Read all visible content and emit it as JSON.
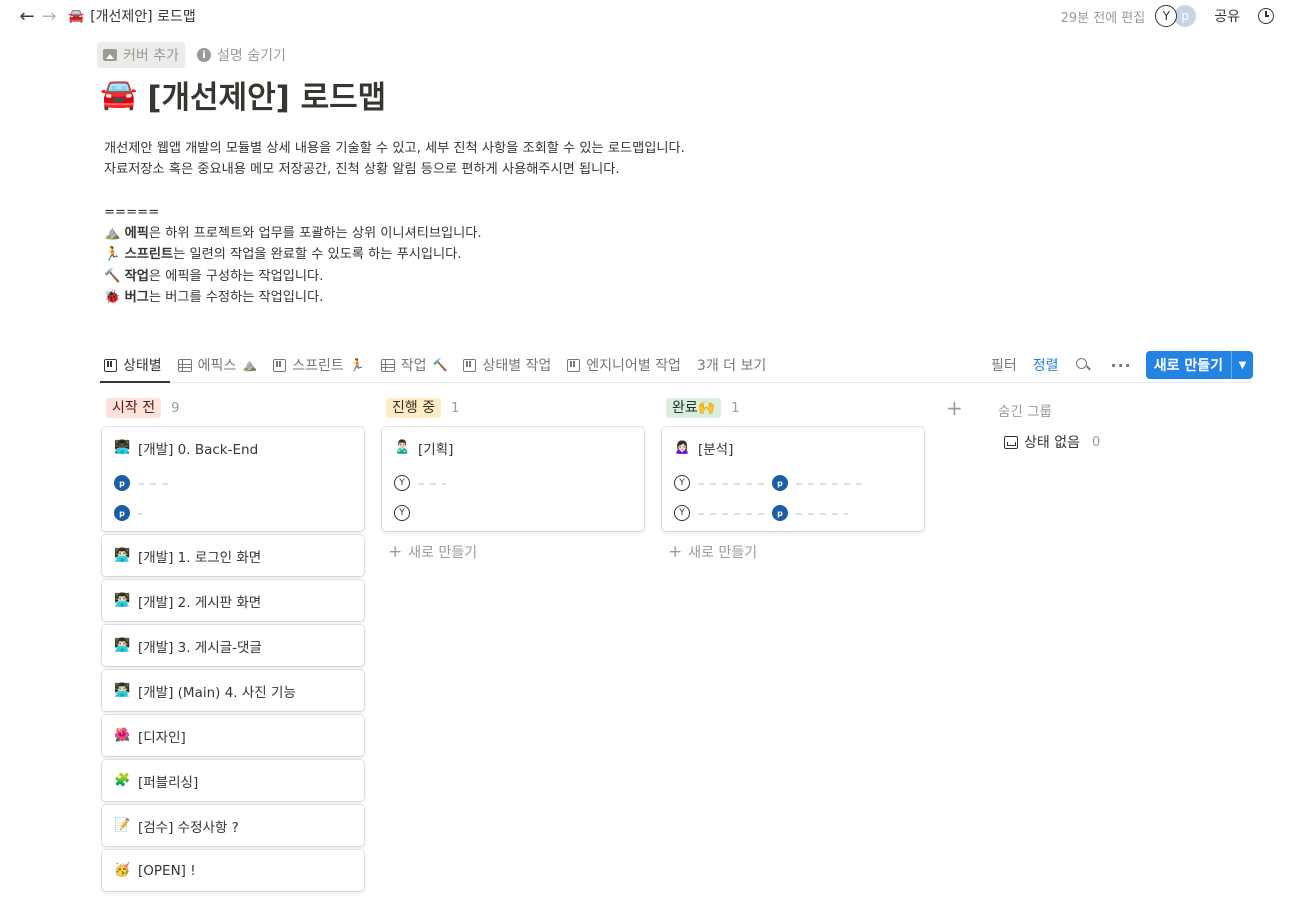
{
  "topbar": {
    "back_icon": "arrow-left-icon",
    "forward_icon": "arrow-right-icon",
    "page_icon": "🚘",
    "breadcrumb": "[개선제안] 로드맵",
    "edited": "29분 전에 편집",
    "avatar_y": "Y",
    "avatar_p": "p",
    "share": "공유",
    "history_icon": "clock-icon"
  },
  "page": {
    "add_cover": "커버 추가",
    "hide_description": "설명 숨기기",
    "title_icon": "🚘",
    "title": "[개선제안] 로드맵",
    "desc_line1": "개선제안 웹앱 개발의 모듈별 상세 내용을 기술할 수 있고, 세부 진척 사항을 조회할 수 있는 로드맵입니다.",
    "desc_line2": "자료저장소 혹은 중요내용 메모 저장공간, 진척 상황 알림 등으로 편하게 사용해주시면 됩니다.",
    "separator": "=====",
    "items": [
      {
        "emoji": "⛰️",
        "bold": "에픽",
        "rest": "은 하위 프로젝트와 업무를 포괄하는 상위 이니셔티브입니다."
      },
      {
        "emoji": "🏃",
        "bold": "스프린트",
        "rest": "는 일련의 작업을 완료할 수 있도록 하는 푸시입니다."
      },
      {
        "emoji": "🔨",
        "bold": "작업",
        "rest": "은 에픽을 구성하는 작업입니다."
      },
      {
        "emoji": "🐞",
        "bold": "버그",
        "rest": "는 버그를 수정하는 작업입니다."
      }
    ]
  },
  "views": {
    "tabs": [
      {
        "label": "상태별",
        "icon": "board-icon",
        "emoji": ""
      },
      {
        "label": "에픽스",
        "icon": "table-icon",
        "emoji": "⛰️"
      },
      {
        "label": "스프린트",
        "icon": "board-icon",
        "emoji": "🏃"
      },
      {
        "label": "작업",
        "icon": "table-icon",
        "emoji": "🔨"
      },
      {
        "label": "상태별 작업",
        "icon": "board-icon",
        "emoji": ""
      },
      {
        "label": "엔지니어별 작업",
        "icon": "board-icon",
        "emoji": ""
      }
    ],
    "more_views": "3개 더 보기",
    "filter": "필터",
    "sort": "정렬",
    "new_button": "새로 만들기"
  },
  "board": {
    "columns": [
      {
        "status": "시작 전",
        "count": "9",
        "color": "#ffe2dd",
        "cards": [
          {
            "emoji": "👨🏿‍💻",
            "title": "[개발] 0. Back-End"
          },
          {
            "emoji": "👨🏻‍💻",
            "title": "[개발] 1. 로그인 화면"
          },
          {
            "emoji": "👨🏻‍💻",
            "title": "[개발] 2. 게시판 화면"
          },
          {
            "emoji": "👨🏻‍💻",
            "title": "[개발] 3. 게시글-댓글"
          },
          {
            "emoji": "👨🏻‍💻",
            "title": "[개발] (Main) 4. 사진 기능"
          },
          {
            "emoji": "🌺",
            "title": "[디자인]"
          },
          {
            "emoji": "🧩",
            "title": "[퍼블리싱]"
          },
          {
            "emoji": "📝",
            "title": "[검수] 수정사항 ?"
          },
          {
            "emoji": "🥳",
            "title": "[OPEN] !"
          }
        ]
      },
      {
        "status": "진행 중",
        "count": "1",
        "color": "#fdecc8",
        "cards": [
          {
            "emoji": "🙎🏻‍♂️",
            "title": "[기획]"
          }
        ],
        "add_new": "새로 만들기"
      },
      {
        "status": "완료🙌",
        "count": "1",
        "color": "#dbeddb",
        "cards": [
          {
            "emoji": "🙍🏻‍♀️",
            "title": "[분석]"
          }
        ],
        "add_new": "새로 만들기"
      }
    ],
    "hidden_groups": "숨긴 그룹",
    "no_status": "상태 없음",
    "no_status_count": "0",
    "person_p": "p",
    "person_y": "Y"
  }
}
